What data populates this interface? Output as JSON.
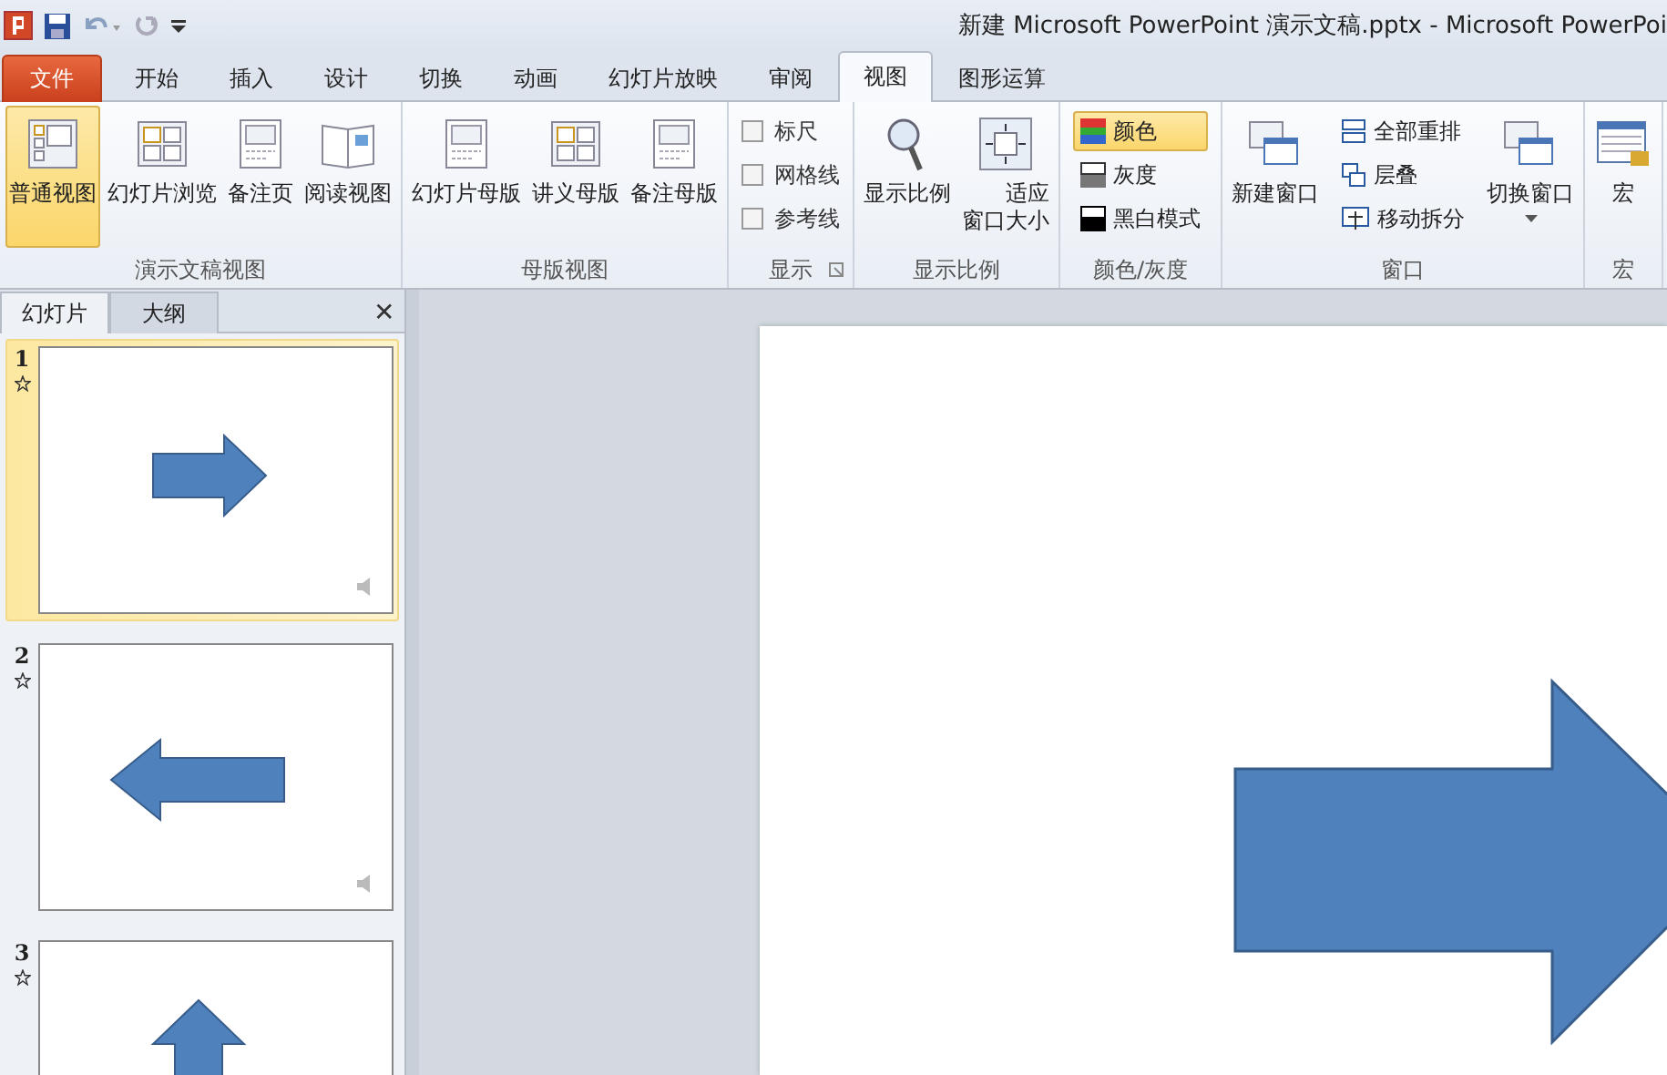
{
  "window": {
    "title": "新建 Microsoft PowerPoint 演示文稿.pptx  -  Microsoft PowerPoi"
  },
  "ribbon_tabs": [
    {
      "label": "文件",
      "kind": "file",
      "selected": false
    },
    {
      "label": "开始",
      "kind": "tab",
      "selected": false
    },
    {
      "label": "插入",
      "kind": "tab",
      "selected": false
    },
    {
      "label": "设计",
      "kind": "tab",
      "selected": false
    },
    {
      "label": "切换",
      "kind": "tab",
      "selected": false
    },
    {
      "label": "动画",
      "kind": "tab",
      "selected": false
    },
    {
      "label": "幻灯片放映",
      "kind": "tab",
      "selected": false
    },
    {
      "label": "审阅",
      "kind": "tab",
      "selected": false
    },
    {
      "label": "视图",
      "kind": "tab",
      "selected": true
    },
    {
      "label": "图形运算",
      "kind": "tab",
      "selected": false
    }
  ],
  "ribbon_groups": [
    {
      "label": "演示文稿视图",
      "launcher": false,
      "columns": [
        [
          {
            "kind": "large",
            "label": "普通视图",
            "selected": true
          }
        ],
        [
          {
            "kind": "large",
            "label": "幻灯片浏览",
            "selected": false
          }
        ],
        [
          {
            "kind": "large",
            "label": "备注页",
            "selected": false
          }
        ],
        [
          {
            "kind": "large",
            "label": "阅读视图",
            "selected": false
          }
        ]
      ]
    },
    {
      "label": "母版视图",
      "launcher": false,
      "columns": [
        [
          {
            "kind": "large",
            "label": "幻灯片母版",
            "selected": false
          }
        ],
        [
          {
            "kind": "large",
            "label": "讲义母版",
            "selected": false
          }
        ],
        [
          {
            "kind": "large",
            "label": "备注母版",
            "selected": false
          }
        ]
      ]
    },
    {
      "label": "显示",
      "launcher": true,
      "columns": [
        [
          {
            "kind": "check",
            "label": "标尺",
            "checked": false
          },
          {
            "kind": "check",
            "label": "网格线",
            "checked": false
          },
          {
            "kind": "check",
            "label": "参考线",
            "checked": false
          }
        ]
      ]
    },
    {
      "label": "显示比例",
      "launcher": false,
      "columns": [
        [
          {
            "kind": "large",
            "label": "显示比例",
            "selected": false
          }
        ],
        [
          {
            "kind": "large",
            "label": "适应",
            "label_2": "窗口大小",
            "selected": false
          }
        ]
      ]
    },
    {
      "label": "颜色/灰度",
      "launcher": false,
      "columns": [
        [
          {
            "kind": "small",
            "label": "颜色",
            "selected": true
          },
          {
            "kind": "small",
            "label": "灰度",
            "selected": false
          },
          {
            "kind": "small",
            "label": "黑白模式",
            "selected": false
          }
        ]
      ]
    },
    {
      "label": "窗口",
      "launcher": false,
      "columns": [
        [
          {
            "kind": "large",
            "label": "新建窗口",
            "selected": false
          }
        ],
        [
          {
            "kind": "small",
            "label": "全部重排",
            "selected": false
          },
          {
            "kind": "small",
            "label": "层叠",
            "selected": false
          },
          {
            "kind": "small",
            "label": "移动拆分",
            "selected": false
          }
        ],
        [
          {
            "kind": "large",
            "label": "切换窗口",
            "selected": false,
            "dropdown": true
          }
        ]
      ]
    },
    {
      "label": "宏",
      "launcher": false,
      "columns": [
        [
          {
            "kind": "large",
            "label": "宏",
            "selected": false
          }
        ]
      ]
    }
  ],
  "pane_tabs": [
    {
      "label": "幻灯片",
      "selected": true
    },
    {
      "label": "大纲",
      "selected": false
    }
  ],
  "pane_close": "✕",
  "slides": [
    {
      "number": "1",
      "selected": true,
      "sound": true,
      "kind": "right_arrow"
    },
    {
      "number": "2",
      "selected": false,
      "sound": true,
      "kind": "left_arrow"
    },
    {
      "number": "3",
      "selected": false,
      "sound": false,
      "kind": "up_arrow"
    }
  ],
  "main_slide": {
    "kind": "right_arrow"
  }
}
